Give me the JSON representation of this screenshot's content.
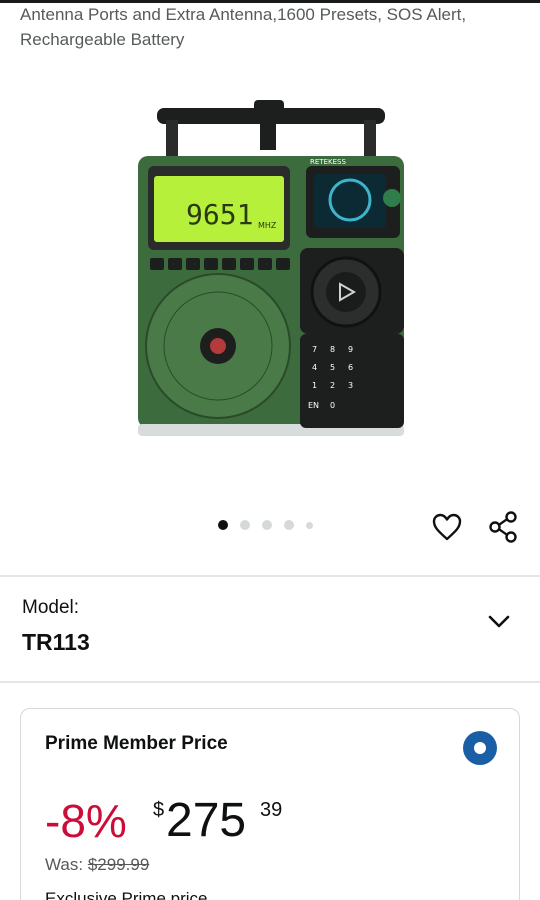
{
  "product": {
    "title": "Antenna Ports and Extra Antenna,1600 Presets, SOS Alert, Rechargeable Battery",
    "image": {
      "display_frequency": "9651",
      "display_unit": "MHZ",
      "brand": "RETEKESS",
      "keypad": [
        "7",
        "8",
        "9",
        "4",
        "5",
        "6",
        "1",
        "2",
        "3",
        "EN",
        "0"
      ],
      "colors": {
        "body": "#3c6b3d",
        "lcd": "#b7f03a",
        "dark": "#1d1f1e"
      }
    }
  },
  "gallery": {
    "dot_count": 5,
    "active_index": 0
  },
  "icons": {
    "favorite": "heart-icon",
    "share": "share-icon",
    "expand": "chevron-down-icon"
  },
  "model": {
    "label": "Model:",
    "value": "TR113"
  },
  "price_card": {
    "title": "Prime Member Price",
    "discount": "-8%",
    "currency": "$",
    "whole": "275",
    "cents": "39",
    "was_label": "Was:",
    "was_price": "$299.99",
    "truncated_text": "Exclusive Prime price",
    "accent_color": "#cc0c39",
    "radio_color": "#1a5fa6"
  }
}
